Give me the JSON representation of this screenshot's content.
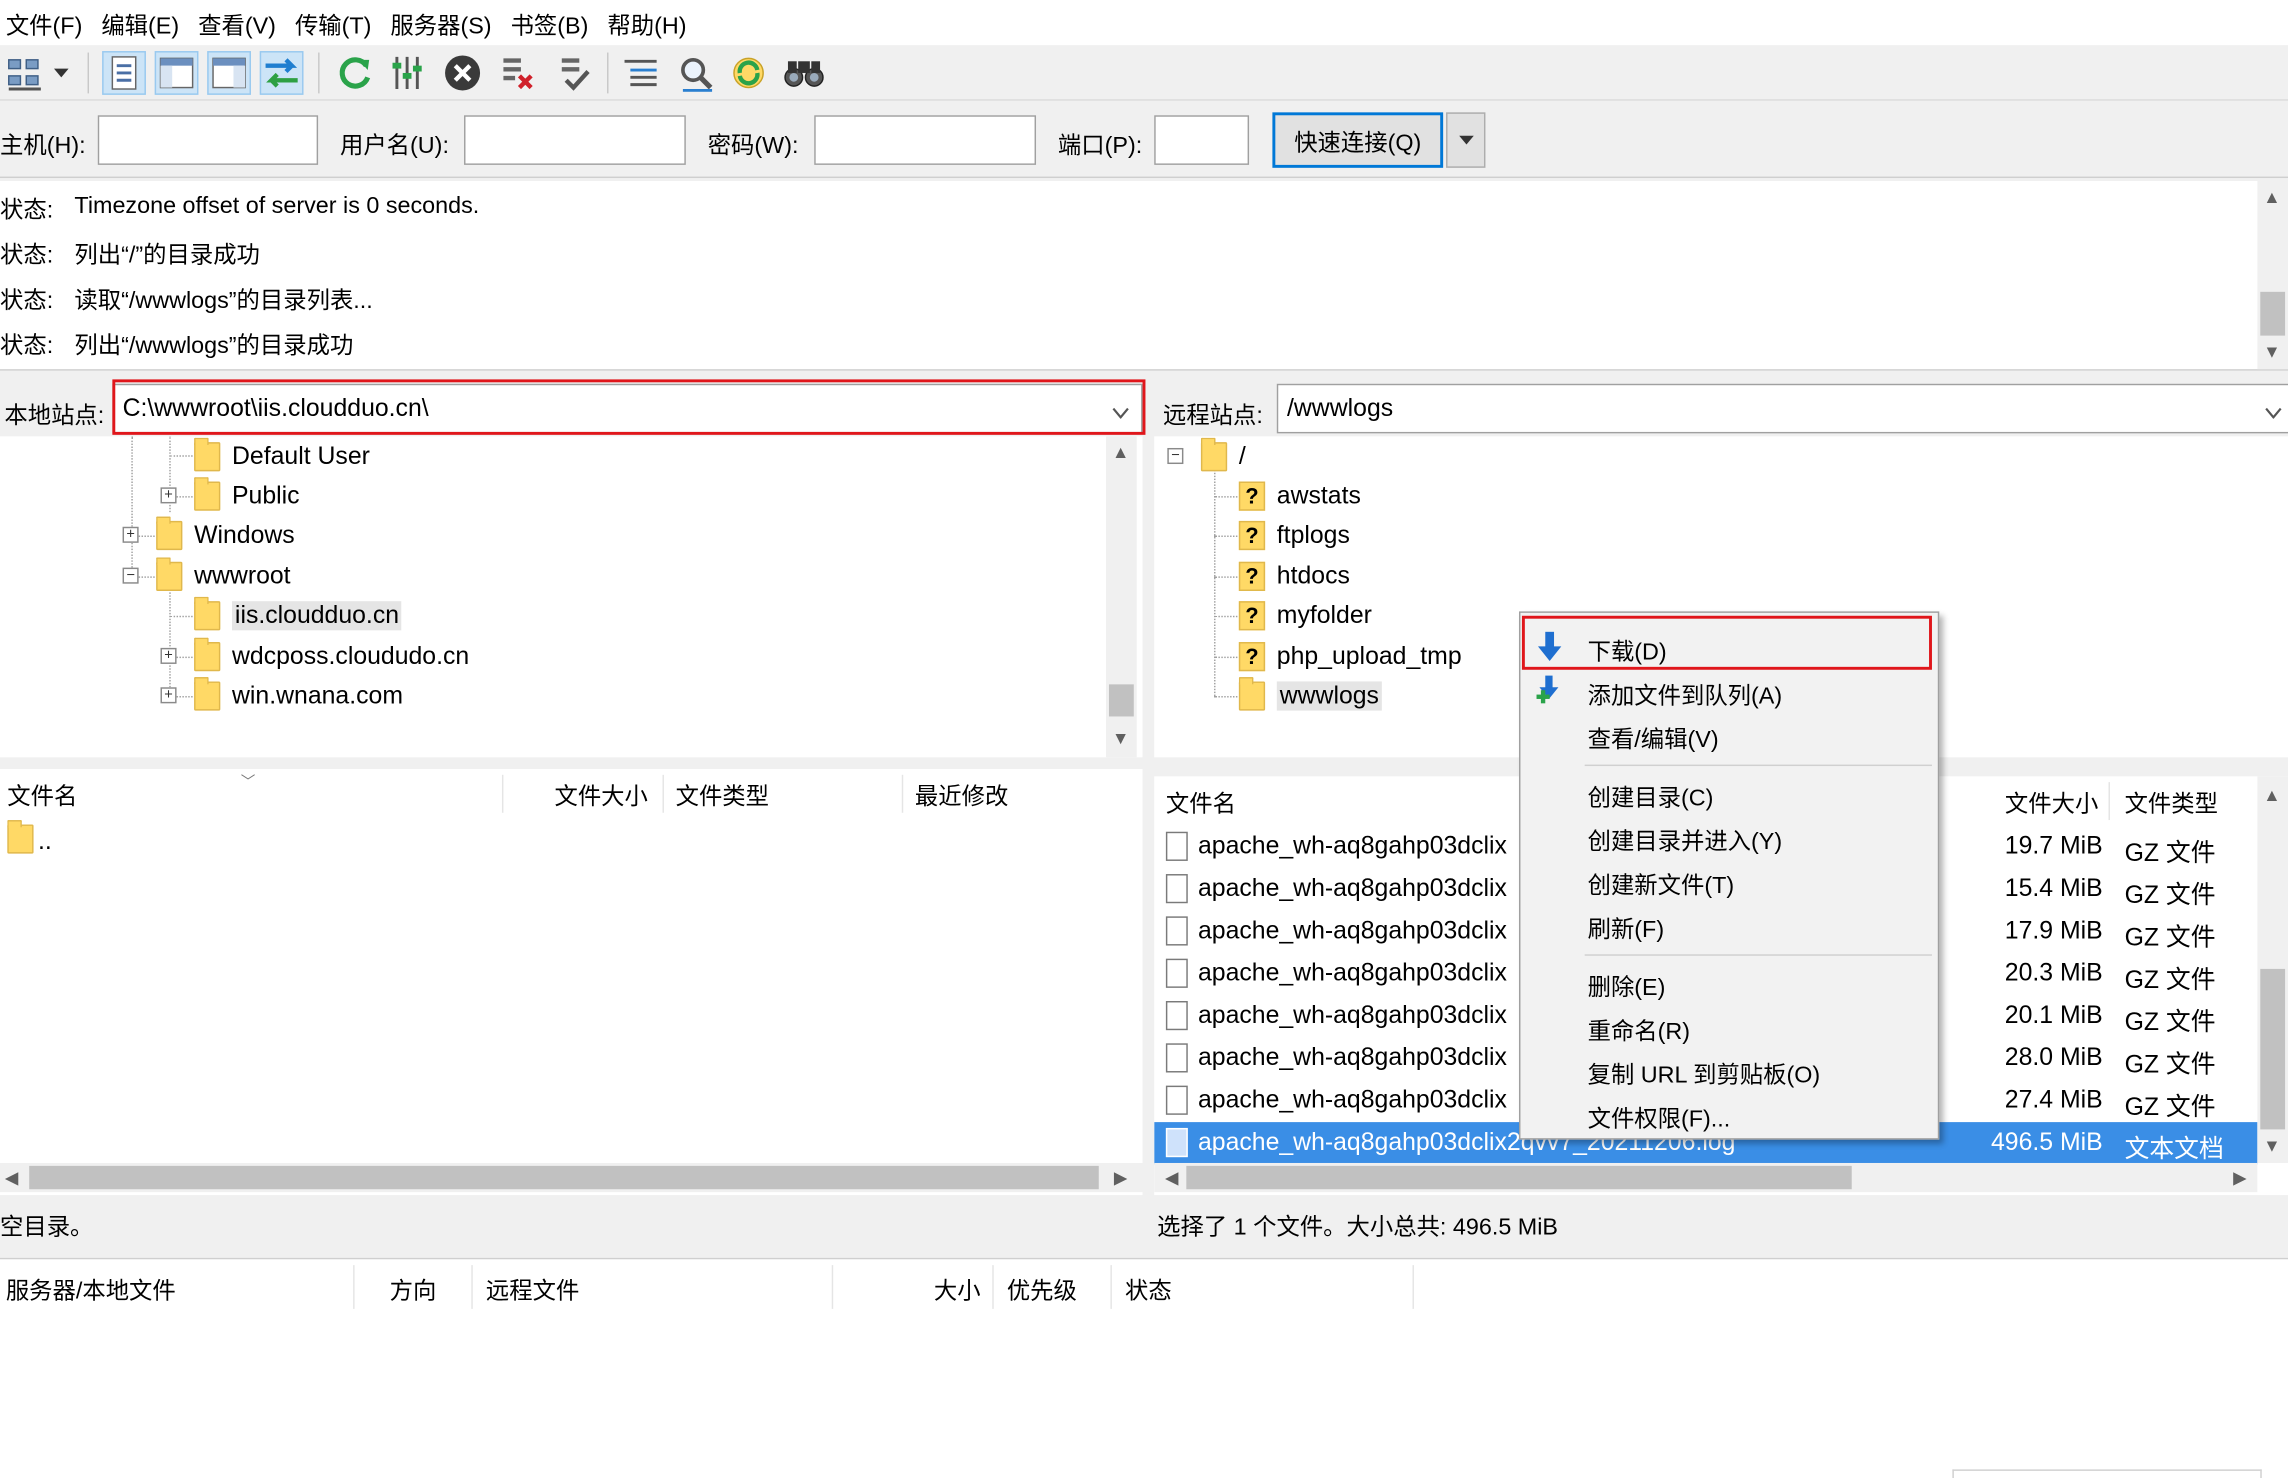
{
  "menu": [
    "文件(F)",
    "编辑(E)",
    "查看(V)",
    "传输(T)",
    "服务器(S)",
    "书签(B)",
    "帮助(H)"
  ],
  "toolbar": {
    "icons": [
      "site-manager-icon",
      "dropdown-arrow-icon",
      "toggle-log-icon",
      "toggle-local-tree-icon",
      "toggle-remote-tree-icon",
      "toggle-queue-icon",
      "refresh-icon",
      "process-queue-icon",
      "cancel-icon",
      "disconnect-icon",
      "reconnect-icon",
      "directory-filter-icon",
      "compare-icon",
      "sync-browse-icon",
      "search-icon"
    ]
  },
  "quickconnect": {
    "host_label": "主机(H):",
    "user_label": "用户名(U):",
    "pass_label": "密码(W):",
    "port_label": "端口(P):",
    "host_value": "",
    "user_value": "",
    "pass_value": "",
    "port_value": "",
    "connect_label": "快速连接(Q)"
  },
  "log": [
    {
      "label": "状态:",
      "text": "Timezone offset of server is 0 seconds."
    },
    {
      "label": "状态:",
      "text": "列出“/”的目录成功"
    },
    {
      "label": "状态:",
      "text": "读取“/wwwlogs”的目录列表..."
    },
    {
      "label": "状态:",
      "text": "列出“/wwwlogs”的目录成功"
    }
  ],
  "local": {
    "site_label": "本地站点:",
    "path": "C:\\wwwroot\\iis.cloudduo.cn\\",
    "tree": [
      "Default User",
      "Public",
      "Windows",
      "wwwroot",
      "iis.cloudduo.cn",
      "wdcposs.cloududo.cn",
      "win.wnana.com"
    ],
    "columns": [
      "文件名",
      "文件大小",
      "文件类型",
      "最近修改"
    ],
    "files": [
      ".."
    ],
    "status": "空目录。"
  },
  "remote": {
    "site_label": "远程站点:",
    "path": "/wwwlogs",
    "tree_root": "/",
    "tree": [
      "awstats",
      "ftplogs",
      "htdocs",
      "myfolder",
      "php_upload_tmp",
      "wwwlogs"
    ],
    "columns": [
      "文件名",
      "文件大小",
      "文件类型"
    ],
    "files": [
      {
        "name": "apache_wh-aq8gahp03dclix",
        "size": "19.7 MiB",
        "type": "GZ 文件"
      },
      {
        "name": "apache_wh-aq8gahp03dclix",
        "size": "15.4 MiB",
        "type": "GZ 文件"
      },
      {
        "name": "apache_wh-aq8gahp03dclix",
        "size": "17.9 MiB",
        "type": "GZ 文件"
      },
      {
        "name": "apache_wh-aq8gahp03dclix",
        "size": "20.3 MiB",
        "type": "GZ 文件"
      },
      {
        "name": "apache_wh-aq8gahp03dclix",
        "size": "20.1 MiB",
        "type": "GZ 文件"
      },
      {
        "name": "apache_wh-aq8gahp03dclix",
        "size": "28.0 MiB",
        "type": "GZ 文件"
      },
      {
        "name": "apache_wh-aq8gahp03dclix",
        "size": "27.4 MiB",
        "type": "GZ 文件"
      },
      {
        "name": "apache_wh-aq8gahp03dclix2qvv7_20211206.log",
        "size": "496.5 MiB",
        "type": "文本文档"
      }
    ],
    "status": "选择了 1 个文件。大小总共: 496.5 MiB"
  },
  "queue": {
    "columns": [
      "服务器/本地文件",
      "方向",
      "远程文件",
      "大小",
      "优先级",
      "状态"
    ]
  },
  "context_menu": {
    "items": [
      "下载(D)",
      "添加文件到队列(A)",
      "查看/编辑(V)",
      "创建目录(C)",
      "创建目录并进入(Y)",
      "创建新文件(T)",
      "刷新(F)",
      "删除(E)",
      "重命名(R)",
      "复制 URL 到剪贴板(O)",
      "文件权限(F)..."
    ]
  },
  "colors": {
    "highlight_red": "#e0161b",
    "selection_blue": "#3a8ee6",
    "accent": "#0078d7"
  }
}
